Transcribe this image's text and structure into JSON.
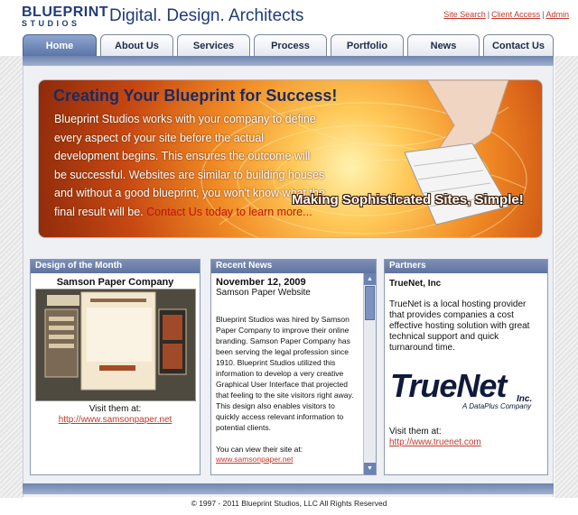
{
  "header": {
    "logo_line1": "BLUEPRINT",
    "logo_line2": "STUDIOS",
    "tagline": "Digital. Design. Architects",
    "links": [
      "Site Search",
      "Client Access",
      "Admin"
    ]
  },
  "nav": {
    "tabs": [
      "Home",
      "About Us",
      "Services",
      "Process",
      "Portfolio",
      "News",
      "Contact Us"
    ],
    "active": "Home"
  },
  "banner": {
    "title": "Creating Your Blueprint for Success!",
    "body": "Blueprint Studios works with your company to define every aspect of your site before the actual development begins. This ensures the outcome will be successful. Websites are similar to building houses and without a good blueprint, you won't know what the final result will be.",
    "cta": "Contact Us today to learn more...",
    "slogan": "Making Sophisticated  Sites, Simple!"
  },
  "design_of_month": {
    "header": "Design of the Month",
    "title": "Samson Paper Company",
    "caption": "Visit them at:",
    "link": "http://www.samsonpaper.net"
  },
  "recent_news": {
    "header": "Recent News",
    "date": "November 12, 2009",
    "subtitle": "Samson Paper Website",
    "body": "Blueprint Studios was hired by Samson Paper Company to improve their online branding. Samson Paper Company has been serving the legal profession since 1910. Blueprint Studios utilized this information to develop a very creative Graphical User Interface that projected that feeling to the site visitors right away. This design also enables visitors to quickly access relevant information to potential clients.",
    "view_text": "You can view their site at:",
    "view_link": "www.samsonpaper.net"
  },
  "partners": {
    "header": "Partners",
    "name": "TrueNet, Inc",
    "description": "TrueNet is a local hosting provider that provides companies a cost effective hosting solution with great technical support and quick turnaround time.",
    "logo_word": "TrueNet",
    "logo_inc": "Inc.",
    "logo_sub": "A DataPlus Company",
    "caption": "Visit them at:",
    "link": "http://www.truenet.com"
  },
  "footer": {
    "copyright": "© 1997 - 2011 Blueprint Studios, LLC All Rights Reserved"
  },
  "colors": {
    "brand_blue": "#1f3b78",
    "link_red": "#c0392b",
    "nav_active": "#5a76a8"
  }
}
